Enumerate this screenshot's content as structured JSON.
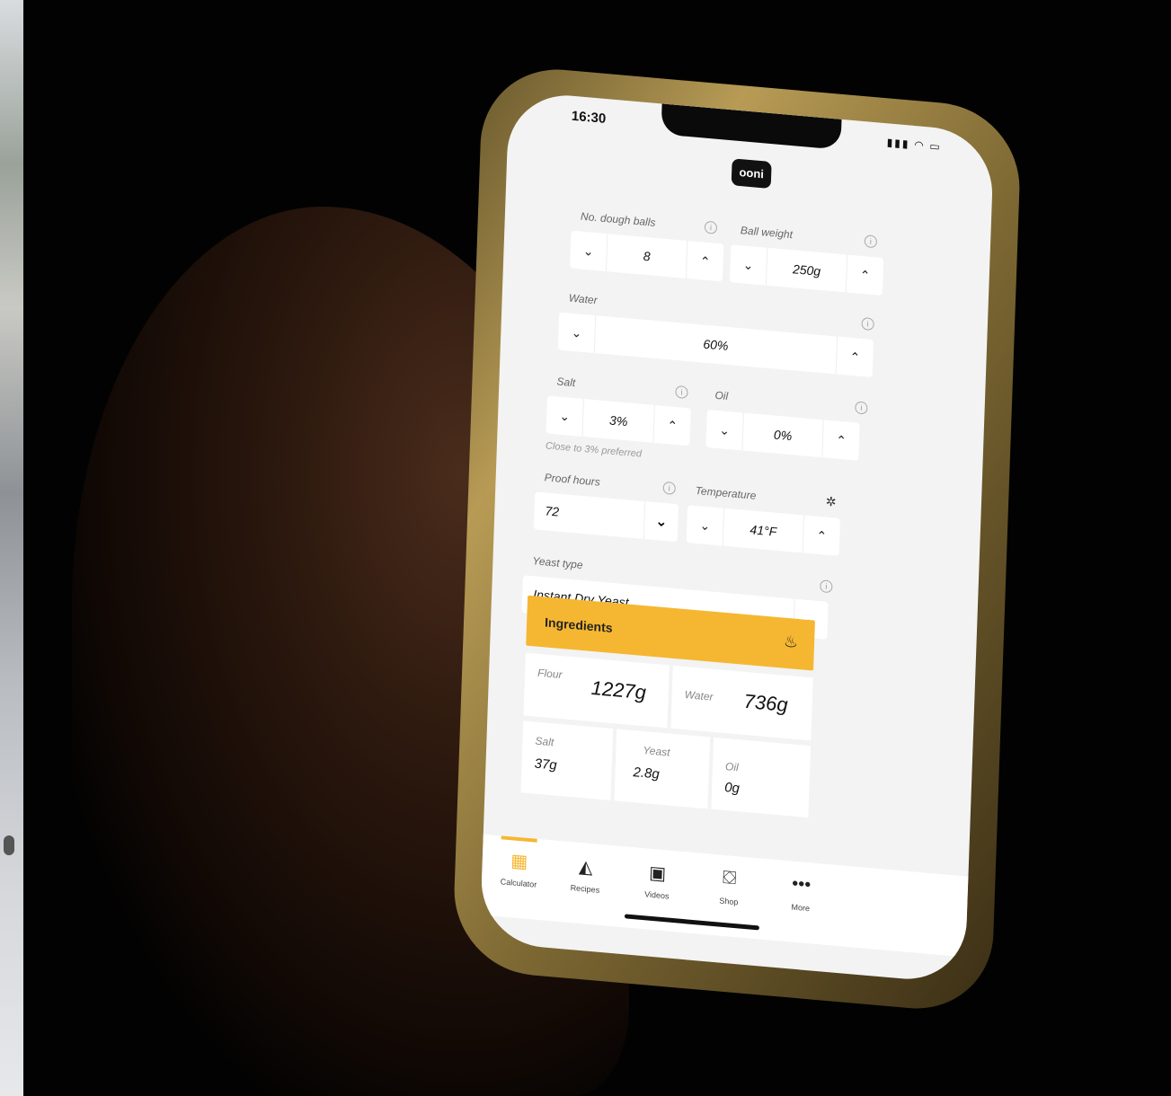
{
  "status": {
    "time": "16:30",
    "icons": "signal wifi battery"
  },
  "logo": "ooni",
  "fields": {
    "dough_balls": {
      "label": "No. dough balls",
      "value": "8"
    },
    "ball_weight": {
      "label": "Ball weight",
      "value": "250g"
    },
    "water": {
      "label": "Water",
      "value": "60%"
    },
    "salt": {
      "label": "Salt",
      "value": "3%",
      "hint": "Close to 3% preferred"
    },
    "oil": {
      "label": "Oil",
      "value": "0%"
    },
    "proof_hours": {
      "label": "Proof hours",
      "value": "72"
    },
    "temperature": {
      "label": "Temperature",
      "value": "41°F"
    },
    "yeast_type": {
      "label": "Yeast type",
      "value": "Instant Dry Yeast"
    }
  },
  "ingredients": {
    "title": "Ingredients",
    "flour": {
      "label": "Flour",
      "value": "1227g"
    },
    "water": {
      "label": "Water",
      "value": "736g"
    },
    "salt": {
      "label": "Salt",
      "value": "37g"
    },
    "yeast": {
      "label": "Yeast",
      "value": "2.8g"
    },
    "oil": {
      "label": "Oil",
      "value": "0g"
    }
  },
  "tabs": [
    {
      "label": "Calculator",
      "icon": "calculator-icon"
    },
    {
      "label": "Recipes",
      "icon": "pizza-icon"
    },
    {
      "label": "Videos",
      "icon": "tv-icon"
    },
    {
      "label": "Shop",
      "icon": "basket-icon"
    },
    {
      "label": "More",
      "icon": "more-icon"
    }
  ],
  "colors": {
    "accent": "#f5b731",
    "background": "#020202",
    "screen": "#f3f3f3"
  }
}
